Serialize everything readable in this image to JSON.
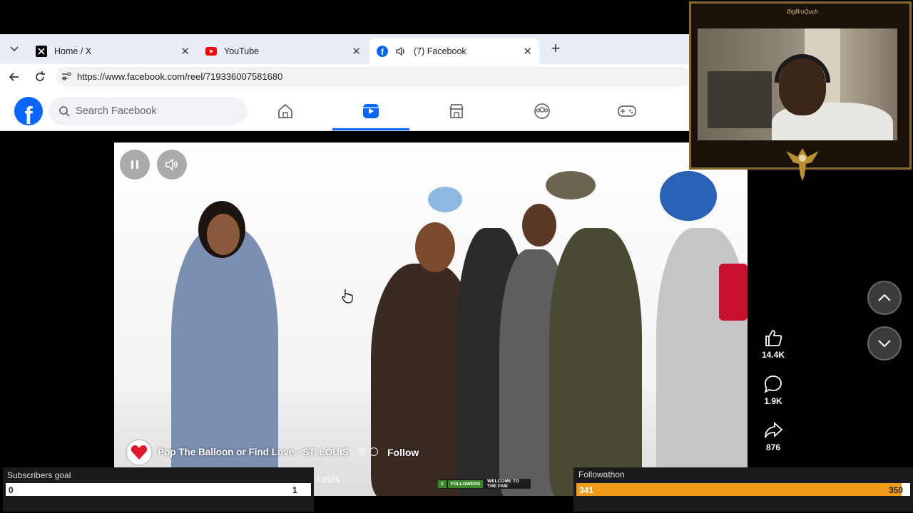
{
  "browser": {
    "tabs": [
      {
        "label": "Home / X",
        "icon": "x-logo-icon"
      },
      {
        "label": "YouTube",
        "icon": "youtube-icon"
      },
      {
        "label": "(7) Facebook",
        "icon": "facebook-icon",
        "muted_icon": "speaker-icon",
        "active": true
      }
    ],
    "url": "https://www.facebook.com/reel/719336007581680"
  },
  "facebook": {
    "search_placeholder": "Search Facebook",
    "nav": [
      "home-icon",
      "reels-icon",
      "marketplace-icon",
      "groups-icon",
      "gaming-icon"
    ]
  },
  "reel": {
    "page_name": "Pop The Balloon or Find Love - ST. LOUIS",
    "follow_label": "Follow",
    "caption_fragment": "Louis",
    "likes": "14.4K",
    "comments": "1.9K",
    "shares": "876"
  },
  "stream": {
    "cam_name": "BigBroQuch",
    "subs_goal": {
      "label": "Subscribers goal",
      "current": "0",
      "target": "1"
    },
    "followathon": {
      "label": "Followathon",
      "current": "341",
      "target": "350",
      "progress": 0.974
    },
    "ticker": {
      "count": "1",
      "followers": "FOLLOWERS",
      "message": "WELCOME TO THE FAM"
    }
  },
  "colors": {
    "facebook_blue": "#0866ff",
    "followathon_orange": "#f39c1c",
    "cam_gold": "#8a6a2a"
  }
}
